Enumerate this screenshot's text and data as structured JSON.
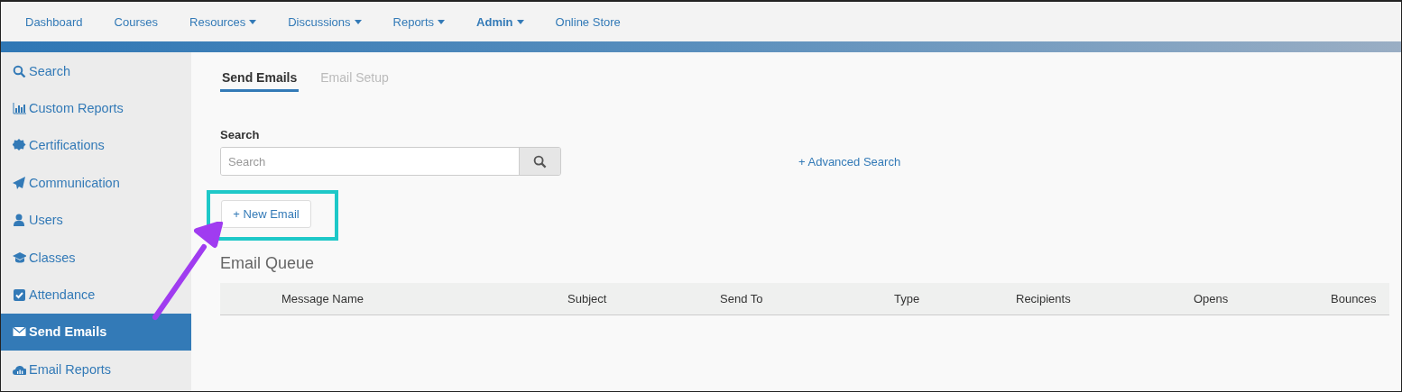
{
  "top_nav": [
    {
      "label": "Dashboard",
      "dropdown": false,
      "selected": false
    },
    {
      "label": "Courses",
      "dropdown": false,
      "selected": false
    },
    {
      "label": "Resources",
      "dropdown": true,
      "selected": false
    },
    {
      "label": "Discussions",
      "dropdown": true,
      "selected": false
    },
    {
      "label": "Reports",
      "dropdown": true,
      "selected": false
    },
    {
      "label": "Admin",
      "dropdown": true,
      "selected": true
    },
    {
      "label": "Online Store",
      "dropdown": false,
      "selected": false
    }
  ],
  "sidebar": {
    "items": [
      {
        "label": "Search",
        "selected": false
      },
      {
        "label": "Custom Reports",
        "selected": false
      },
      {
        "label": "Certifications",
        "selected": false
      },
      {
        "label": "Communication",
        "selected": false
      },
      {
        "label": "Users",
        "selected": false
      },
      {
        "label": "Classes",
        "selected": false
      },
      {
        "label": "Attendance",
        "selected": false
      },
      {
        "label": "Send Emails",
        "selected": true
      },
      {
        "label": "Email Reports",
        "selected": false
      }
    ]
  },
  "tabs": [
    {
      "label": "Send Emails",
      "selected": true
    },
    {
      "label": "Email Setup",
      "selected": false
    }
  ],
  "search": {
    "label": "Search",
    "placeholder": "Search",
    "advanced_link": "+ Advanced Search"
  },
  "new_email_button": "+ New Email",
  "queue": {
    "title": "Email Queue",
    "columns": [
      "Message Name",
      "Subject",
      "Send To",
      "Type",
      "Recipients",
      "Opens",
      "Bounces"
    ]
  },
  "annotations": [
    {
      "kind": "highlight",
      "color": "#1ec8c8"
    },
    {
      "kind": "arrow",
      "color": "#a03cf0"
    }
  ]
}
